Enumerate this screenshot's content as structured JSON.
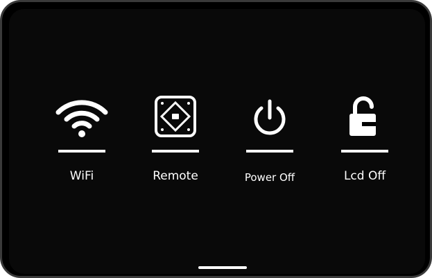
{
  "menu": {
    "items": [
      {
        "label": "WiFi",
        "icon": "wifi-icon"
      },
      {
        "label": "Remote",
        "icon": "remote-icon"
      },
      {
        "label": "Power Off",
        "icon": "power-icon"
      },
      {
        "label": "Lcd Off",
        "icon": "unlock-icon"
      }
    ]
  },
  "colors": {
    "background": "#090909",
    "frame": "#3a3a3a",
    "foreground": "#ffffff"
  }
}
